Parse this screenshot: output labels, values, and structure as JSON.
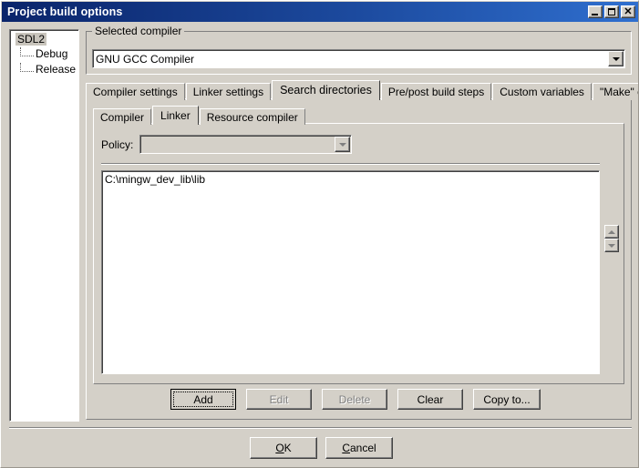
{
  "window": {
    "title": "Project build options",
    "titlebar_buttons": [
      {
        "name": "minimize",
        "glyph": "_"
      },
      {
        "name": "maximize",
        "glyph": "□"
      },
      {
        "name": "close",
        "glyph": "✕"
      }
    ]
  },
  "tree": {
    "root": "SDL2",
    "children": [
      "Debug",
      "Release"
    ]
  },
  "compiler_group": {
    "legend": "Selected compiler",
    "selected": "GNU GCC Compiler"
  },
  "outer_tabs": [
    {
      "label": "Compiler settings",
      "active": false
    },
    {
      "label": "Linker settings",
      "active": false
    },
    {
      "label": "Search directories",
      "active": true
    },
    {
      "label": "Pre/post build steps",
      "active": false
    },
    {
      "label": "Custom variables",
      "active": false
    },
    {
      "label": "\"Make\" commands",
      "active": false
    }
  ],
  "inner_tabs": [
    {
      "label": "Compiler",
      "active": false
    },
    {
      "label": "Linker",
      "active": true
    },
    {
      "label": "Resource compiler",
      "active": false
    }
  ],
  "policy": {
    "label": "Policy:",
    "value": ""
  },
  "directories": [
    "C:\\mingw_dev_lib\\lib"
  ],
  "spinners": [
    {
      "name": "move-up",
      "glyph": "▲"
    },
    {
      "name": "move-down",
      "glyph": "▼"
    }
  ],
  "action_buttons": [
    {
      "label": "Add",
      "state": "default-focused"
    },
    {
      "label": "Edit",
      "state": "disabled"
    },
    {
      "label": "Delete",
      "state": "disabled"
    },
    {
      "label": "Clear",
      "state": "enabled"
    },
    {
      "label": "Copy to...",
      "state": "enabled"
    }
  ],
  "dialog_buttons": [
    {
      "label": "OK",
      "accel": "O"
    },
    {
      "label": "Cancel",
      "accel": "C"
    }
  ],
  "colors": {
    "face": "#d4d0c8",
    "titlebar_start": "#0a246a",
    "titlebar_end": "#2f6fcf",
    "field": "#ffffff",
    "disabled_text": "#808080",
    "tree_selection": "#c8c4bc"
  }
}
